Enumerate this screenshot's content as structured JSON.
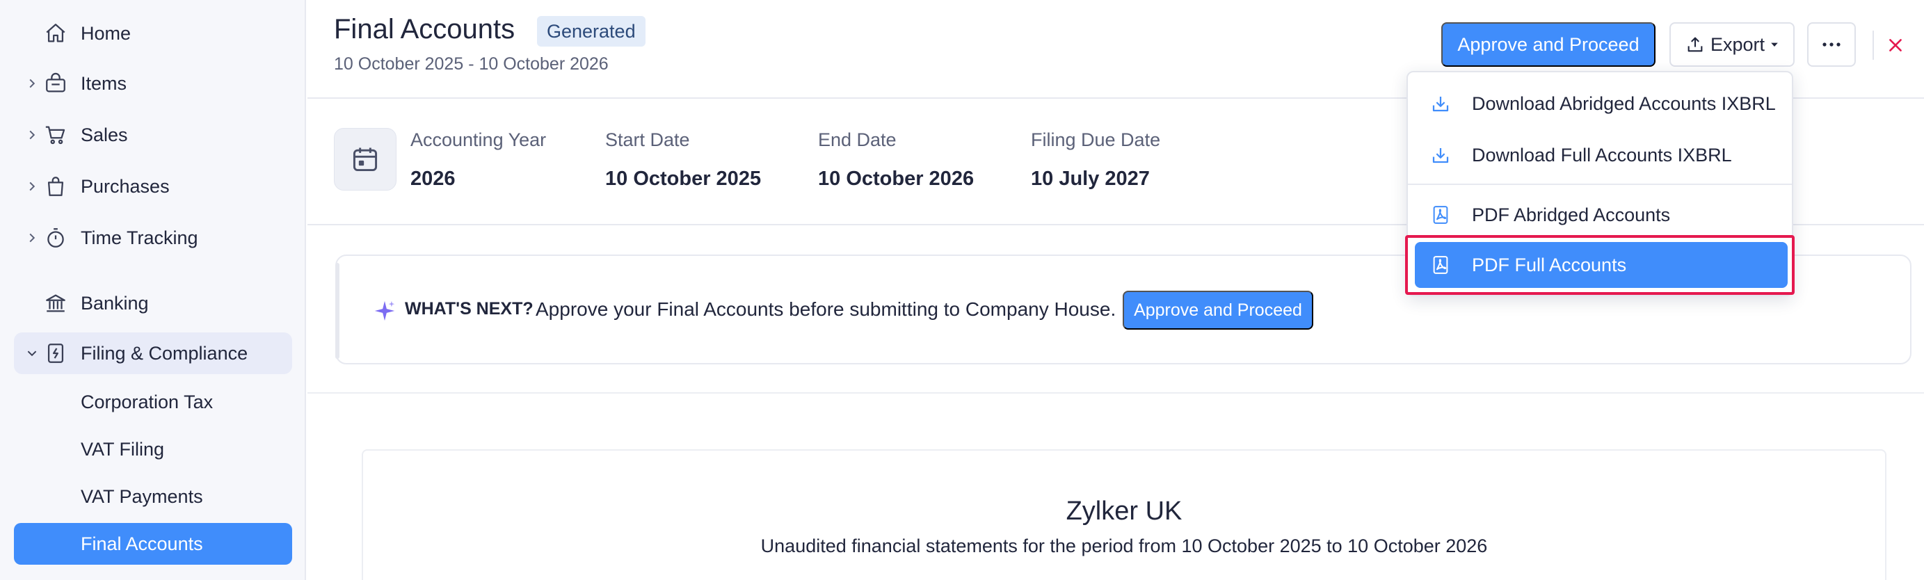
{
  "sidebar": {
    "items": [
      {
        "label": "Home",
        "icon": "home-icon"
      },
      {
        "label": "Items",
        "icon": "basket-icon"
      },
      {
        "label": "Sales",
        "icon": "cart-icon"
      },
      {
        "label": "Purchases",
        "icon": "bag-icon"
      },
      {
        "label": "Time Tracking",
        "icon": "stopwatch-icon"
      },
      {
        "label": "Banking",
        "icon": "bank-icon"
      },
      {
        "label": "Filing & Compliance",
        "icon": "filing-icon"
      }
    ],
    "subitems": [
      {
        "label": "Corporation Tax"
      },
      {
        "label": "VAT Filing"
      },
      {
        "label": "VAT Payments"
      },
      {
        "label": "Final Accounts"
      }
    ]
  },
  "header": {
    "title": "Final Accounts",
    "status": "Generated",
    "period": "10 October 2025 - 10 October 2026",
    "approve_label": "Approve and Proceed",
    "export_label": "Export"
  },
  "info": {
    "accounting_year_label": "Accounting Year",
    "accounting_year": "2026",
    "start_date_label": "Start Date",
    "start_date": "10 October 2025",
    "end_date_label": "End Date",
    "end_date": "10 October 2026",
    "filing_due_label": "Filing Due Date",
    "filing_due": "10 July 2027"
  },
  "next": {
    "title": "WHAT'S NEXT?",
    "text": "Approve your Final Accounts before submitting to Company House.",
    "button_label": "Approve and Proceed"
  },
  "statement": {
    "company": "Zylker UK",
    "subtitle": "Unaudited financial statements for the period from 10 October 2025 to 10 October 2026"
  },
  "export_menu": {
    "items": [
      {
        "label": "Download Abridged Accounts IXBRL",
        "icon": "download-icon"
      },
      {
        "label": "Download Full Accounts IXBRL",
        "icon": "download-icon"
      },
      {
        "label": "PDF Abridged Accounts",
        "icon": "pdf-icon"
      },
      {
        "label": "PDF Full Accounts",
        "icon": "pdf-icon"
      }
    ],
    "highlighted_index": 3
  },
  "colors": {
    "accent": "#408dfb",
    "highlight_frame": "#e5194f",
    "close": "#e5194f"
  }
}
